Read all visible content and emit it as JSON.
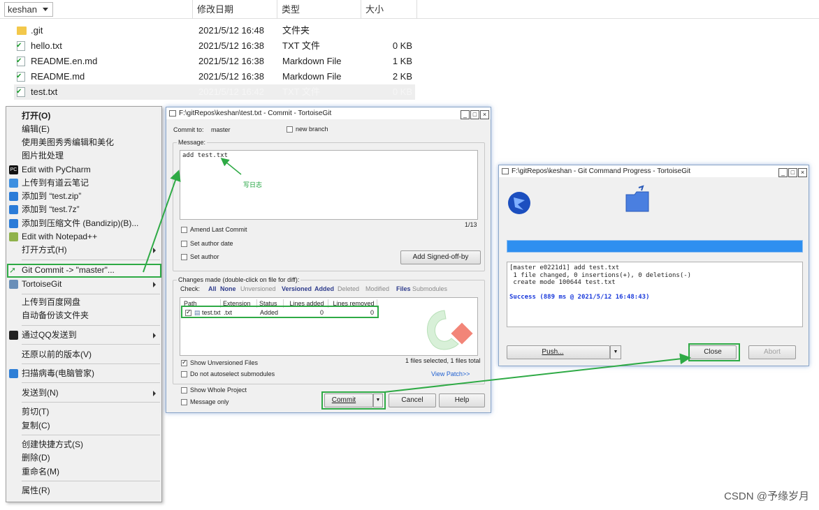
{
  "explorer": {
    "columns": {
      "name": "keshan",
      "date": "修改日期",
      "type": "类型",
      "size": "大小"
    },
    "files": [
      {
        "name": ".git",
        "date": "2021/5/12 16:48",
        "type": "文件夹",
        "size": "",
        "icon": "folder-icon"
      },
      {
        "name": "hello.txt",
        "date": "2021/5/12 16:38",
        "type": "TXT 文件",
        "size": "0 KB",
        "icon": "git-file-icon"
      },
      {
        "name": "README.en.md",
        "date": "2021/5/12 16:38",
        "type": "Markdown File",
        "size": "1 KB",
        "icon": "git-file-icon"
      },
      {
        "name": "README.md",
        "date": "2021/5/12 16:38",
        "type": "Markdown File",
        "size": "2 KB",
        "icon": "git-file-icon"
      },
      {
        "name": "test.txt",
        "date": "2021/5/12 16:42",
        "type": "TXT 文件",
        "size": "0 KB",
        "icon": "git-file-icon"
      }
    ]
  },
  "context_menu": {
    "items": [
      "打开(O)",
      "编辑(E)",
      "使用美图秀秀编辑和美化",
      "图片批处理",
      "Edit with PyCharm",
      "上传到有道云笔记",
      "添加到 “test.zip”",
      "添加到 “test.7z”",
      "添加到压缩文件 (Bandizip)(B)...",
      "Edit with Notepad++",
      "打开方式(H)",
      "Git Commit -> \"master\"...",
      "TortoiseGit",
      "上传到百度网盘",
      "自动备份该文件夹",
      "通过QQ发送到",
      "还原以前的版本(V)",
      "扫描病毒(电脑管家)",
      "发送到(N)",
      "剪切(T)",
      "复制(C)",
      "创建快捷方式(S)",
      "删除(D)",
      "重命名(M)",
      "属性(R)"
    ]
  },
  "commit": {
    "title": "F:\\gitRepos\\keshan\\test.txt - Commit - TortoiseGit",
    "commit_to_label": "Commit to:",
    "branch": "master",
    "new_branch": "new branch",
    "message_label": "Message:",
    "message": "add test.txt",
    "annotation": "写日志",
    "counter": "1/13",
    "amend": "Amend Last Commit",
    "set_author_date": "Set author date",
    "set_author": "Set author",
    "signed_off": "Add Signed-off-by",
    "changes_label": "Changes made (double-click on file for diff):",
    "check_label": "Check:",
    "filters": [
      "All",
      "None",
      "Unversioned",
      "Versioned",
      "Added",
      "Deleted",
      "Modified",
      "Files",
      "Submodules"
    ],
    "table_headers": [
      "Path",
      "Extension",
      "Status",
      "Lines added",
      "Lines removed"
    ],
    "row": {
      "path": "test.txt",
      "ext": ".txt",
      "status": "Added",
      "added": "0",
      "removed": "0"
    },
    "show_unversioned": "Show Unversioned Files",
    "no_autoselect": "Do not autoselect submodules",
    "selected_info": "1 files selected, 1 files total",
    "view_patch": "View Patch>>",
    "show_whole": "Show Whole Project",
    "message_only": "Message only",
    "btn_commit": "Commit",
    "btn_cancel": "Cancel",
    "btn_help": "Help"
  },
  "progress": {
    "title": "F:\\gitRepos\\keshan - Git Command Progress - TortoiseGit",
    "log_lines": [
      "[master e0221d1] add test.txt",
      " 1 file changed, 0 insertions(+), 0 deletions(-)",
      " create mode 100644 test.txt"
    ],
    "success": "Success (889 ms @ 2021/5/12 16:48:43)",
    "btn_push": "Push...",
    "btn_close": "Close",
    "btn_abort": "Abort"
  },
  "watermark": "CSDN @予缘岁月",
  "colors": {
    "highlight": "#2eaa45",
    "progress": "#2e8ff0"
  }
}
